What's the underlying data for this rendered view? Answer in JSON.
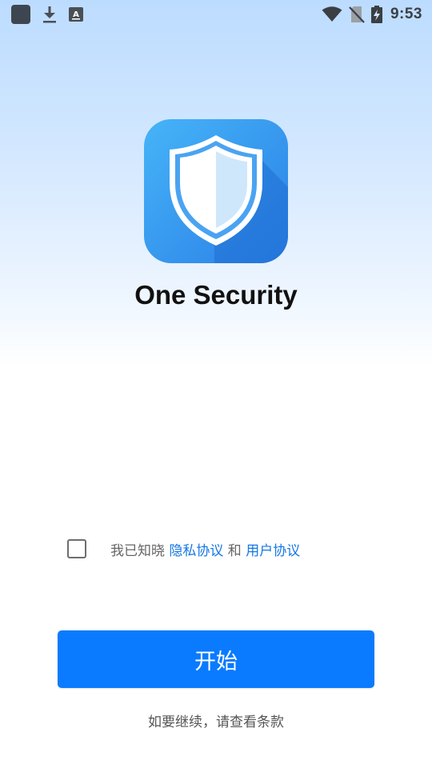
{
  "status_bar": {
    "time": "9:53",
    "icons": [
      "app-notification-icon",
      "download-icon",
      "text-a-icon",
      "wifi-icon",
      "no-sim-icon",
      "battery-charging-icon"
    ]
  },
  "app": {
    "name": "One Security",
    "logo_icon": "shield-icon",
    "brand_color": "#2f8ff0"
  },
  "agreement": {
    "prefix": "我已知晓 ",
    "privacy_link": "隐私协议",
    "conjunction": " 和 ",
    "user_link": "用户协议",
    "checked": false,
    "link_color": "#1677e6"
  },
  "start_button": {
    "label": "开始",
    "color": "#0a7bff"
  },
  "hint": "如要继续，请查看条款"
}
